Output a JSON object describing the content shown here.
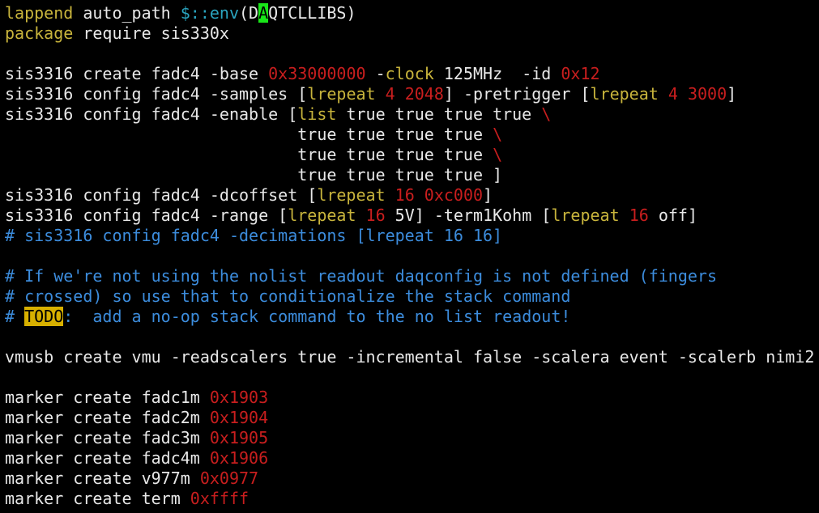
{
  "colors": {
    "background": "#000000",
    "text": "#e8e8e8",
    "keyword": "#c8b43c",
    "number": "#c81e1e",
    "variable": "#2aa4bf",
    "comment": "#3c8cdc",
    "cursor": "#19e619",
    "todo_highlight": "#d7b000"
  },
  "editor": {
    "lines": [
      [
        [
          "kw",
          "lappend"
        ],
        [
          "text",
          " auto_path "
        ],
        [
          "var",
          "$::env"
        ],
        [
          "text",
          "(D"
        ],
        [
          "cur",
          "A"
        ],
        [
          "text",
          "QTCLLIBS)"
        ]
      ],
      [
        [
          "kw",
          "package"
        ],
        [
          "text",
          " require sis330x"
        ]
      ],
      [],
      [
        [
          "text",
          "sis3316 create fadc4 -base "
        ],
        [
          "num",
          "0x33000000"
        ],
        [
          "text",
          " -"
        ],
        [
          "kw",
          "clock"
        ],
        [
          "text",
          " 125MHz  -id "
        ],
        [
          "num",
          "0x12"
        ]
      ],
      [
        [
          "text",
          "sis3316 config fadc4 -samples ["
        ],
        [
          "kw",
          "lrepeat"
        ],
        [
          "text",
          " "
        ],
        [
          "num",
          "4"
        ],
        [
          "text",
          " "
        ],
        [
          "num",
          "2048"
        ],
        [
          "text",
          "] -pretrigger ["
        ],
        [
          "kw",
          "lrepeat"
        ],
        [
          "text",
          " "
        ],
        [
          "num",
          "4"
        ],
        [
          "text",
          " "
        ],
        [
          "num",
          "3000"
        ],
        [
          "text",
          "]"
        ]
      ],
      [
        [
          "text",
          "sis3316 config fadc4 -enable ["
        ],
        [
          "kw",
          "list"
        ],
        [
          "text",
          " true true true true "
        ],
        [
          "num",
          "\\"
        ]
      ],
      [
        [
          "text",
          "                              true true true true "
        ],
        [
          "num",
          "\\"
        ]
      ],
      [
        [
          "text",
          "                              true true true true "
        ],
        [
          "num",
          "\\"
        ]
      ],
      [
        [
          "text",
          "                              true true true true ]"
        ]
      ],
      [
        [
          "text",
          "sis3316 config fadc4 -dcoffset ["
        ],
        [
          "kw",
          "lrepeat"
        ],
        [
          "text",
          " "
        ],
        [
          "num",
          "16"
        ],
        [
          "text",
          " "
        ],
        [
          "num",
          "0xc000"
        ],
        [
          "text",
          "]"
        ]
      ],
      [
        [
          "text",
          "sis3316 config fadc4 -range ["
        ],
        [
          "kw",
          "lrepeat"
        ],
        [
          "text",
          " "
        ],
        [
          "num",
          "16"
        ],
        [
          "text",
          " 5V] -term1Kohm ["
        ],
        [
          "kw",
          "lrepeat"
        ],
        [
          "text",
          " "
        ],
        [
          "num",
          "16"
        ],
        [
          "text",
          " off]"
        ]
      ],
      [
        [
          "cmt",
          "# sis3316 config fadc4 -decimations [lrepeat 16 16]"
        ]
      ],
      [],
      [
        [
          "cmt",
          "# If we're not using the nolist readout daqconfig is not defined (fingers"
        ]
      ],
      [
        [
          "cmt",
          "# crossed) so use that to conditionalize the stack command"
        ]
      ],
      [
        [
          "cmt",
          "# "
        ],
        [
          "todo",
          "TODO"
        ],
        [
          "cmt",
          ":  add a no-op stack command to the no list readout!"
        ]
      ],
      [],
      [
        [
          "text",
          "vmusb create vmu -readscalers true -incremental false -scalera event -scalerb nimi2"
        ]
      ],
      [],
      [
        [
          "text",
          "marker create fadc1m "
        ],
        [
          "num",
          "0x1903"
        ]
      ],
      [
        [
          "text",
          "marker create fadc2m "
        ],
        [
          "num",
          "0x1904"
        ]
      ],
      [
        [
          "text",
          "marker create fadc3m "
        ],
        [
          "num",
          "0x1905"
        ]
      ],
      [
        [
          "text",
          "marker create fadc4m "
        ],
        [
          "num",
          "0x1906"
        ]
      ],
      [
        [
          "text",
          "marker create v977m "
        ],
        [
          "num",
          "0x0977"
        ]
      ],
      [
        [
          "text",
          "marker create term "
        ],
        [
          "num",
          "0xffff"
        ]
      ]
    ]
  }
}
